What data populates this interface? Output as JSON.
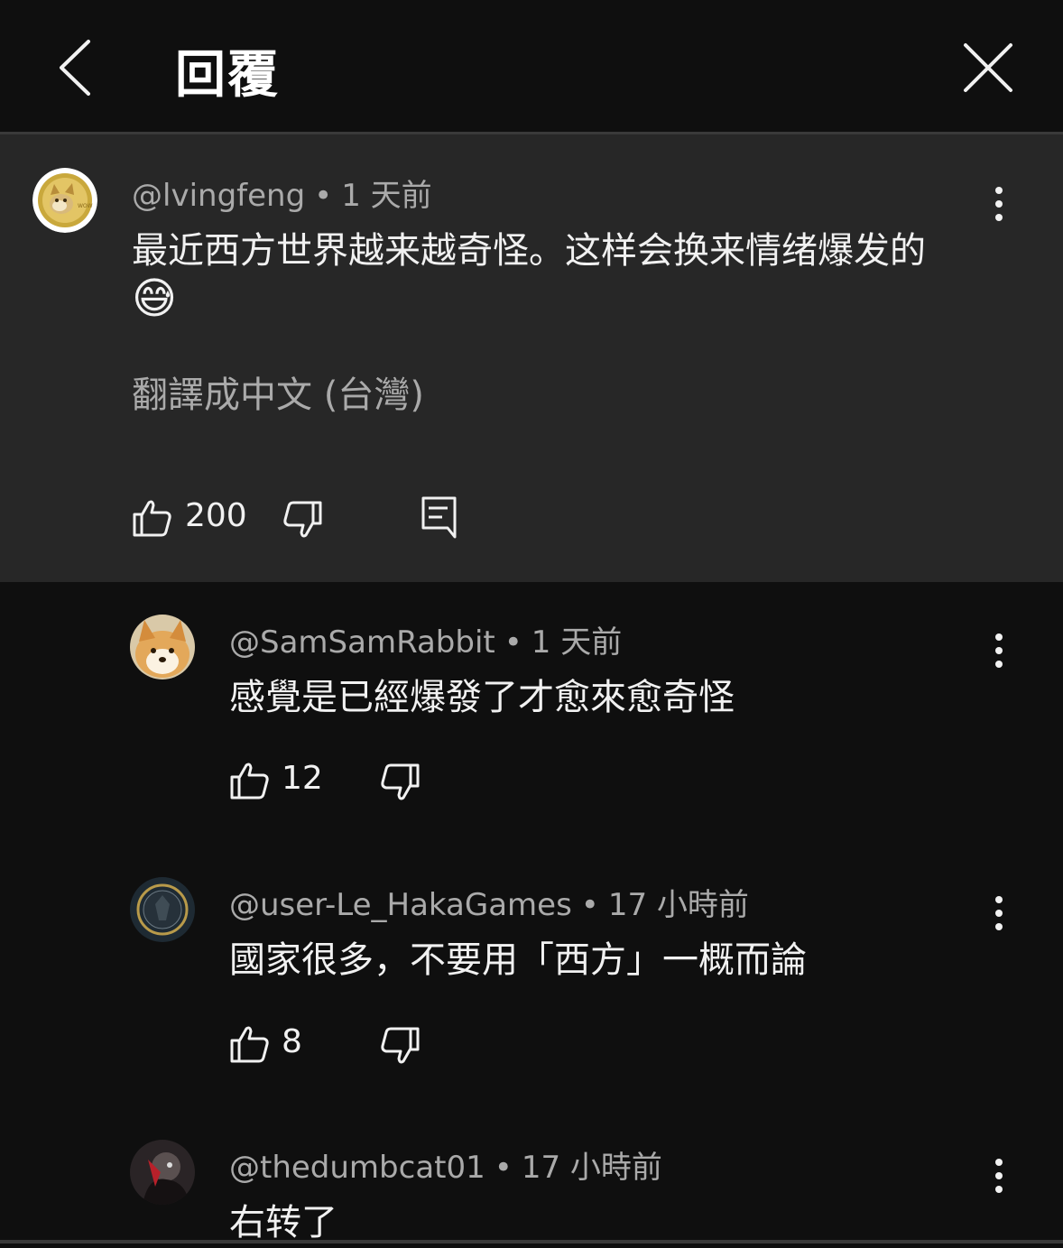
{
  "header": {
    "title": "回覆",
    "back_icon": "chevron-left-icon",
    "close_icon": "close-icon"
  },
  "pinned_comment": {
    "author": "@lvingfeng",
    "time": "1 天前",
    "text": "最近西方世界越来越奇怪。这样会换来情绪爆发的",
    "emoji": "😅",
    "translate_label": "翻譯成中文 (台灣)",
    "likes": "200"
  },
  "replies": [
    {
      "author": "@SamSamRabbit",
      "time": "1 天前",
      "text": "感覺是已經爆發了才愈來愈奇怪",
      "likes": "12"
    },
    {
      "author": "@user-Le_HakaGames",
      "time": "17 小時前",
      "text": "國家很多，不要用「西方」一概而論",
      "likes": "8"
    },
    {
      "author": "@thedumbcat01",
      "time": "17 小時前",
      "text": "右转了",
      "likes": ""
    }
  ],
  "meta_separator": "•",
  "colors": {
    "background": "#0f0f0f",
    "highlight": "#272727",
    "secondary_text": "#aaaaaa",
    "primary_text": "#f1f1f1"
  }
}
